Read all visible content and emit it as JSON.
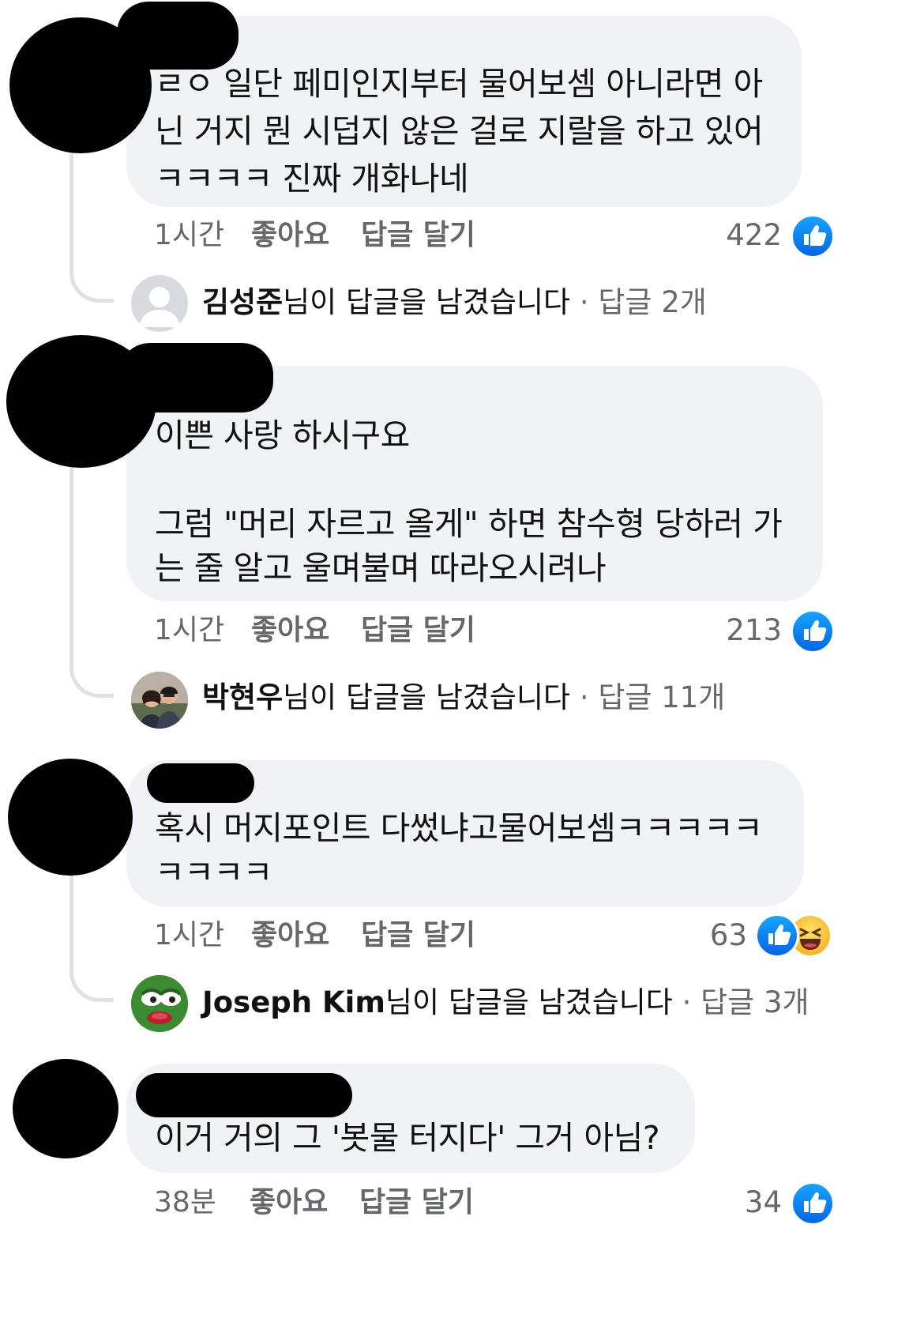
{
  "comments": [
    {
      "text": "ㄹㅇ 일단 페미인지부터 물어보셈 아니라면 아\n닌 거지 뭔 시덥지 않은 걸로 지랄을 하고 있어\nㅋㅋㅋㅋ 진짜 개화나네",
      "time": "1시간",
      "like_label": "좋아요",
      "reply_label": "답글 달기",
      "reaction_count": "422",
      "reactions": [
        "like-icon"
      ],
      "replies": {
        "name": "김성준",
        "suffix": "님이 답글을 남겼습니다",
        "count": "· 답글 2개",
        "avatar": "default-avatar-icon"
      }
    },
    {
      "text": "이쁜 사랑 하시구요\n\n그럼 \"머리 자르고 올게\" 하면 참수형 당하러 가\n는 줄 알고 울며불며 따라오시려나",
      "time": "1시간",
      "like_label": "좋아요",
      "reply_label": "답글 달기",
      "reaction_count": "213",
      "reactions": [
        "like-icon"
      ],
      "replies": {
        "name": "박현우",
        "suffix": "님이 답글을 남겼습니다",
        "count": "· 답글 11개",
        "avatar": "couple-photo-avatar"
      }
    },
    {
      "text": "혹시 머지포인트 다썼냐고물어보셈ㅋㅋㅋㅋㅋ\nㅋㅋㅋㅋ",
      "time": "1시간",
      "like_label": "좋아요",
      "reply_label": "답글 달기",
      "reaction_count": "63",
      "reactions": [
        "like-icon",
        "haha-icon"
      ],
      "replies": {
        "name": "Joseph Kim",
        "suffix": "님이 답글을 남겼습니다",
        "count": "· 답글 3개",
        "avatar": "pepe-frog-avatar"
      }
    },
    {
      "text": "이거 거의 그 '봇물 터지다' 그거 아님?",
      "time": "38분",
      "like_label": "좋아요",
      "reply_label": "답글 달기",
      "reaction_count": "34",
      "reactions": [
        "like-icon"
      ]
    }
  ],
  "colors": {
    "bubble": "#f0f2f5",
    "meta_text": "#65676b",
    "like_blue": "#1877f2",
    "thread_line": "#dfe1e5",
    "redaction": "#000000"
  }
}
